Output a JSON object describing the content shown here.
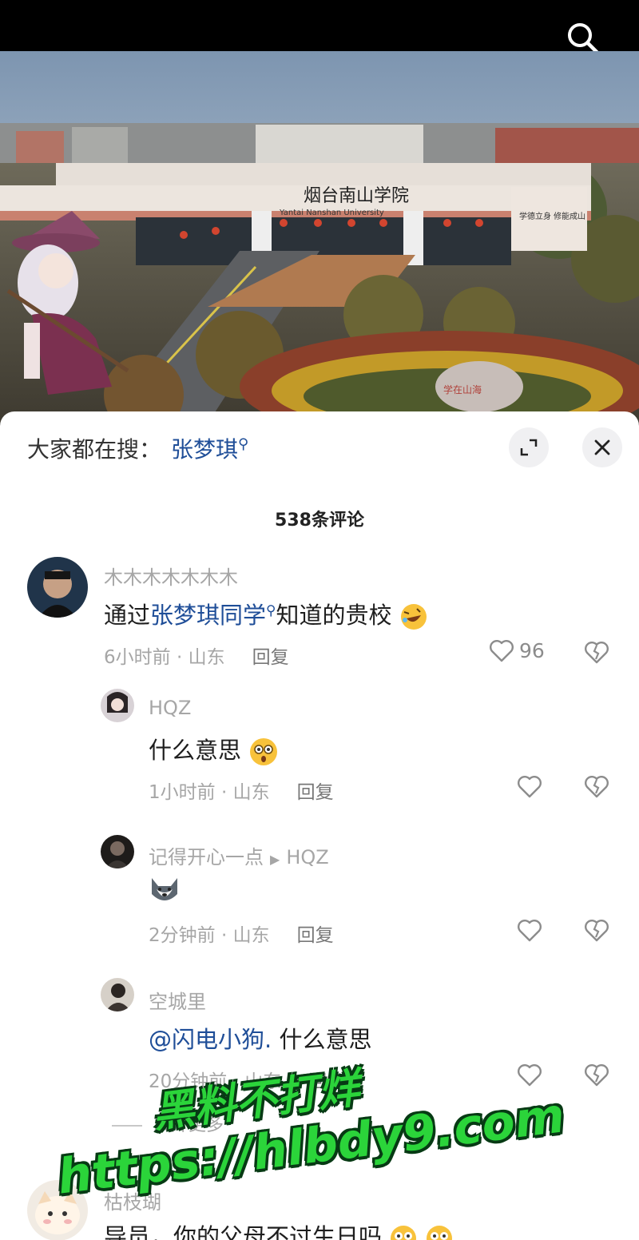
{
  "top_bar": {
    "search_icon": "search-icon"
  },
  "scene": {
    "gate_sign": "烟台南山学院",
    "gate_sign_en": "Yantai Nanshan University",
    "motto": "学德立身 修能成山",
    "stone": "学在山海"
  },
  "sheet": {
    "trending_prefix": "大家都在搜：",
    "trending_keyword": "张梦琪",
    "expand_icon": "expand-icon",
    "close_icon": "close-icon",
    "comment_count": "538条评论",
    "comments": [
      {
        "username": "木木木木木木木",
        "text_before": "通过",
        "text_link": "张梦琪同学",
        "text_after": "知道的贵校",
        "time": "6小时前",
        "location": "山东",
        "reply_label": "回复",
        "likes": "96"
      },
      {
        "username": "HQZ",
        "text": "什么意思",
        "time": "1小时前",
        "location": "山东",
        "reply_label": "回复"
      },
      {
        "username": "记得开心一点",
        "reply_to": "HQZ",
        "time": "2分钟前",
        "location": "山东",
        "reply_label": "回复"
      },
      {
        "username": "空城里",
        "mention": "@闪电小狗.",
        "text": "什么意思",
        "time": "20分钟前",
        "location": "山东",
        "reply_label": "回复"
      },
      {
        "username": "枯枝瑚",
        "text": "导员，你的父母不过生日吗"
      }
    ],
    "collapse_label": "展开更多"
  },
  "watermark": {
    "line1": "黑料不打烊",
    "line2": "https://hlbdy9.com"
  },
  "colors": {
    "link": "#1f4e98",
    "meta": "#a6a6a6",
    "watermark": "#2bd43a"
  }
}
